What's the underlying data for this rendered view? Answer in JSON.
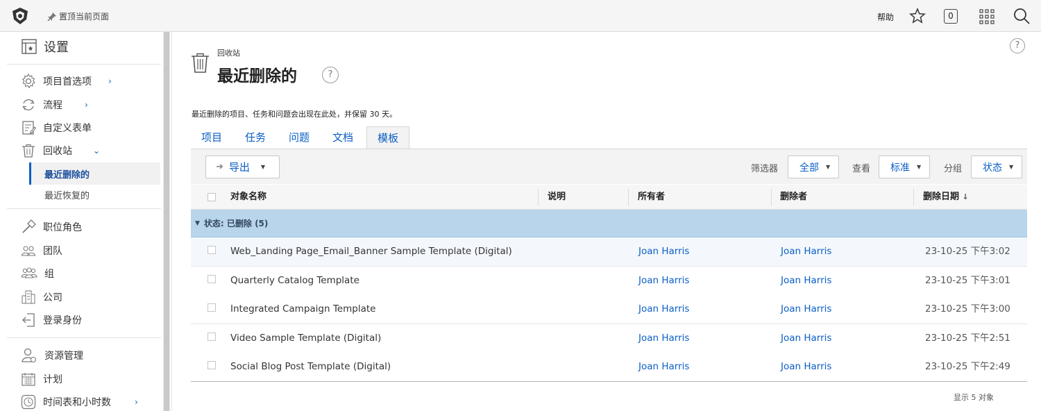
{
  "topbar": {
    "pin_label": "置顶当前页面",
    "help_label": "帮助",
    "count": "0"
  },
  "sidebar": {
    "title": "设置",
    "items": [
      {
        "label": "项目首选项",
        "icon": "gear-icon",
        "chevron": "›"
      },
      {
        "label": "流程",
        "icon": "refresh-icon",
        "chevron": "›"
      },
      {
        "label": "自定义表单",
        "icon": "form-icon"
      },
      {
        "label": "回收站",
        "icon": "trash-icon",
        "chevron": "⌄"
      }
    ],
    "subitems": [
      {
        "label": "最近删除的",
        "active": true
      },
      {
        "label": "最近恢复的"
      }
    ],
    "items2": [
      {
        "label": "职位角色",
        "icon": "hammer-icon"
      },
      {
        "label": "团队",
        "icon": "team-icon"
      },
      {
        "label": "组",
        "icon": "group-icon"
      },
      {
        "label": "公司",
        "icon": "building-icon"
      },
      {
        "label": "登录身份",
        "icon": "login-as-icon"
      }
    ],
    "items3": [
      {
        "label": "资源管理",
        "icon": "resource-icon"
      },
      {
        "label": "计划",
        "icon": "calendar-icon"
      },
      {
        "label": "时间表和小时数",
        "icon": "clock-icon",
        "chevron": "›"
      }
    ]
  },
  "page": {
    "breadcrumb": "回收站",
    "title": "最近删除的",
    "description": "最近删除的项目、任务和问题会出现在此处，并保留 30 天。"
  },
  "tabs": [
    "项目",
    "任务",
    "问题",
    "文档",
    "模板"
  ],
  "active_tab": "模板",
  "toolbar": {
    "export_label": "导出",
    "filter_label": "筛选器",
    "filter_value": "全部",
    "view_label": "查看",
    "view_value": "标准",
    "group_label": "分组",
    "group_value": "状态"
  },
  "table": {
    "columns": [
      "对象名称",
      "说明",
      "所有者",
      "删除者",
      "删除日期"
    ],
    "sort_indicator": "↓",
    "group_header": "状态: 已删除 (5)",
    "rows": [
      {
        "name": "Web_Landing Page_Email_Banner Sample Template (Digital)",
        "description": "",
        "owner": "Joan Harris",
        "deleted_by": "Joan Harris",
        "deleted_on": "23-10-25 下午3:02"
      },
      {
        "name": "Quarterly Catalog Template",
        "description": "",
        "owner": "Joan Harris",
        "deleted_by": "Joan Harris",
        "deleted_on": "23-10-25 下午3:01"
      },
      {
        "name": "Integrated Campaign Template",
        "description": "",
        "owner": "Joan Harris",
        "deleted_by": "Joan Harris",
        "deleted_on": "23-10-25 下午3:00"
      },
      {
        "name": "Video Sample Template (Digital)",
        "description": "",
        "owner": "Joan Harris",
        "deleted_by": "Joan Harris",
        "deleted_on": "23-10-25 下午2:51"
      },
      {
        "name": "Social Blog Post Template (Digital)",
        "description": "",
        "owner": "Joan Harris",
        "deleted_by": "Joan Harris",
        "deleted_on": "23-10-25 下午2:49"
      }
    ],
    "footer": "显示 5 对象"
  },
  "colors": {
    "accent": "#0b5ec6",
    "group_row": "#b8d5ec"
  }
}
